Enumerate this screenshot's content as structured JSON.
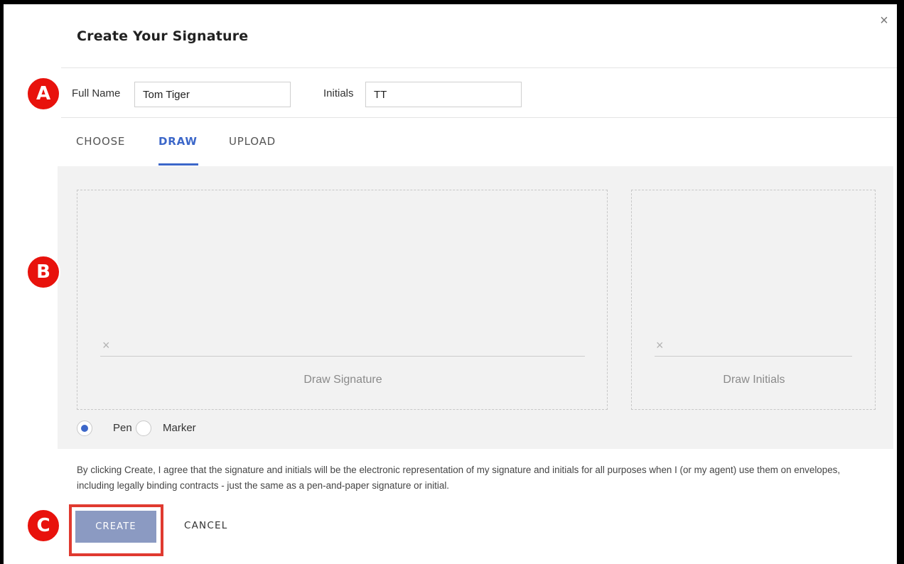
{
  "dialog": {
    "title": "Create Your Signature",
    "close_icon": "×"
  },
  "fields": {
    "full_name_label": "Full Name",
    "full_name_value": "Tom Tiger",
    "initials_label": "Initials",
    "initials_value": "TT"
  },
  "tabs": [
    {
      "label": "CHOOSE",
      "active": false
    },
    {
      "label": "DRAW",
      "active": true
    },
    {
      "label": "UPLOAD",
      "active": false
    }
  ],
  "draw": {
    "signature_x": "×",
    "signature_caption": "Draw Signature",
    "initials_x": "×",
    "initials_caption": "Draw Initials"
  },
  "pen_options": [
    {
      "label": "Pen",
      "selected": true
    },
    {
      "label": "Marker",
      "selected": false
    }
  ],
  "legal_text": "By clicking Create, I agree that the signature and initials will be the electronic representation of my signature and initials for all purposes when I (or my agent) use them on envelopes, including legally binding contracts - just the same as a pen-and-paper signature or initial.",
  "actions": {
    "create_label": "CREATE",
    "cancel_label": "CANCEL"
  },
  "badges": {
    "a": "A",
    "b": "B",
    "c": "C"
  },
  "colors": {
    "accent": "#3c67c9",
    "create_button": "#8b9ac2",
    "badge_red": "#e8120c",
    "highlight_red": "#e03a30"
  }
}
